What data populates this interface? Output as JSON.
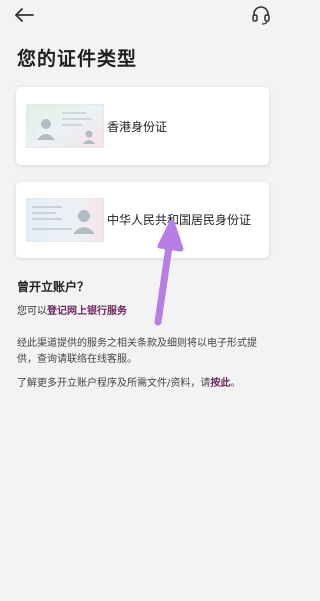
{
  "header": {
    "title": "您的证件类型"
  },
  "id_cards": [
    {
      "label": "香港身份证"
    },
    {
      "label": "中华人民共和国居民身份证"
    }
  ],
  "existing_account": {
    "heading": "曾开立账户？",
    "prefix": "您可以",
    "link": "登记网上银行服务"
  },
  "terms_text": "经此渠道提供的服务之相关条款及细则将以电子形式提供，查询请联络在线客服。",
  "more_info": {
    "prefix": "了解更多开立账户程序及所需文件/资料，请",
    "link": "按此",
    "suffix": "。"
  },
  "colors": {
    "background": "#f4f3f3",
    "link": "#6b2a5f",
    "annotation_arrow": "#b77ee6"
  },
  "icons": [
    "back-arrow-icon",
    "headset-icon",
    "hk-id-card-icon",
    "cn-id-card-icon"
  ]
}
